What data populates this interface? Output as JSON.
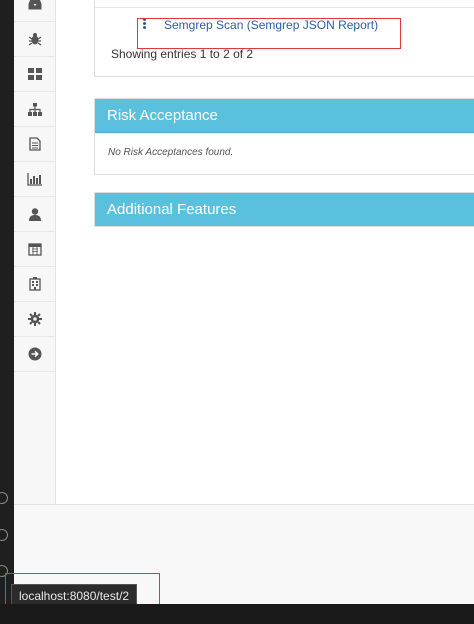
{
  "sidebar": {
    "items": [
      {
        "icon": "inbox-icon",
        "label": ""
      },
      {
        "icon": "bug-icon",
        "label": ""
      },
      {
        "icon": "grid-icon",
        "label": ""
      },
      {
        "icon": "sitemap-icon",
        "label": ""
      },
      {
        "icon": "document-icon",
        "label": ""
      },
      {
        "icon": "bar-chart-icon",
        "label": ""
      },
      {
        "icon": "user-icon",
        "label": ""
      },
      {
        "icon": "calendar-icon",
        "label": ""
      },
      {
        "icon": "building-icon",
        "label": ""
      },
      {
        "icon": "gear-icon",
        "label": ""
      },
      {
        "icon": "arrow-right-circle-icon",
        "label": ""
      }
    ]
  },
  "tests_panel": {
    "scan_link": "Semgrep Scan (Semgrep JSON Report)",
    "entries_text": "Showing entries 1 to 2 of 2"
  },
  "risk_panel": {
    "title": "Risk Acceptance",
    "empty_text": "No Risk Acceptances found."
  },
  "features_panel": {
    "title": "Additional Features"
  },
  "status_bar": {
    "url": "localhost:8080/test/2"
  },
  "colors": {
    "panel_heading": "#5bc0de",
    "link": "#2a5fa5",
    "highlight_box": "#e0383e"
  }
}
